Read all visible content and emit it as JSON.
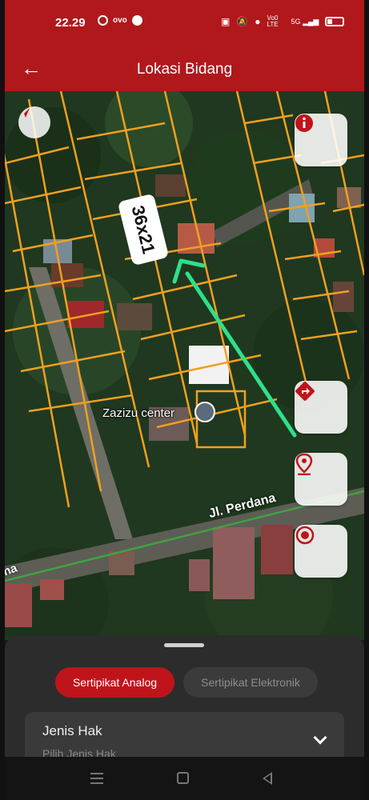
{
  "status_bar": {
    "time": "22.29",
    "left_icons": [
      "whatsapp-icon",
      "ovo-icon",
      "facebook-icon"
    ],
    "right_icons": [
      "nfc-icon",
      "mute-icon",
      "location-icon",
      "volte-icon",
      "signal-icon",
      "battery-icon"
    ],
    "volte_text": "Vo0 LTE",
    "net_text": "5G"
  },
  "app_bar": {
    "title": "Lokasi Bidang",
    "back_icon": "arrow-left-icon"
  },
  "map": {
    "size_label": "36x21",
    "poi_label": "Zazizu center",
    "road_label": "Jl. Perdana",
    "road_label_cut": "na",
    "buttons": {
      "info": "info-icon",
      "directions": "directions-icon",
      "location_pin": "location-pin-icon",
      "my_location": "my-location-icon",
      "compass": "compass-icon"
    },
    "colors": {
      "parcel_outline": "#f0a020",
      "arrow": "#2ee08a",
      "road_line": "#3fa33f"
    }
  },
  "bottom_sheet": {
    "tabs": [
      {
        "label": "Sertipikat Analog",
        "active": true
      },
      {
        "label": "Sertipikat Elektronik",
        "active": false
      }
    ],
    "field": {
      "label": "Jenis Hak",
      "placeholder": "Pilih Jenis Hak"
    }
  },
  "colors": {
    "primary": "#b0181c",
    "sheet_bg": "#2c2c2c"
  }
}
